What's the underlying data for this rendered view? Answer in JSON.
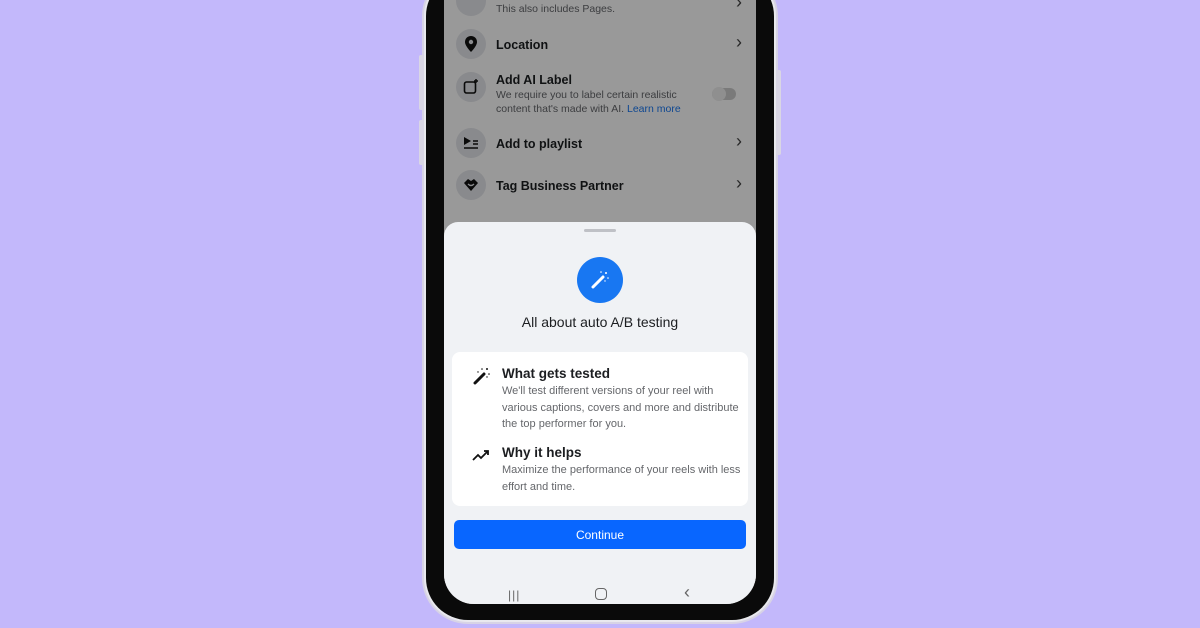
{
  "background_list": {
    "items": [
      {
        "label": "",
        "subtitle": "This also includes Pages.",
        "icon": "people-icon",
        "action": "chevron"
      },
      {
        "label": "Location",
        "icon": "location-pin-icon",
        "action": "chevron"
      },
      {
        "label": "Add AI Label",
        "subtitle": "We require you to label certain realistic content that's made with AI.",
        "link": "Learn more",
        "icon": "ai-label-icon",
        "action": "toggle",
        "toggle_on": false
      },
      {
        "label": "Add to playlist",
        "icon": "playlist-icon",
        "action": "chevron"
      },
      {
        "label": "Tag Business Partner",
        "icon": "handshake-icon",
        "action": "chevron"
      }
    ]
  },
  "sheet": {
    "icon": "magic-wand-icon",
    "title": "All about auto A/B testing",
    "sections": [
      {
        "icon": "magic-wand-icon",
        "title": "What gets tested",
        "text": "We'll test different versions of your reel with various captions, covers and more and distribute the top performer for you."
      },
      {
        "icon": "trending-up-icon",
        "title": "Why it helps",
        "text": "Maximize the performance of your reels with less effort and time."
      }
    ],
    "continue_label": "Continue"
  },
  "colors": {
    "accent": "#0866ff",
    "background": "#c3b8fb",
    "link": "#1877f2"
  }
}
